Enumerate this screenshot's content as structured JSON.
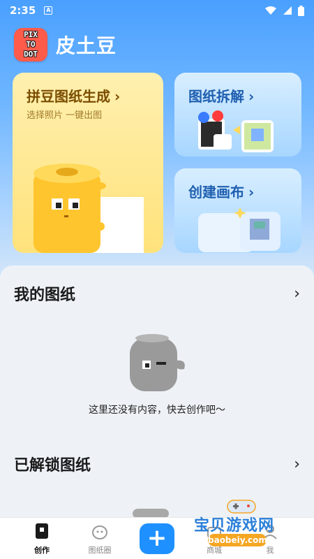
{
  "status_bar": {
    "time": "2:35",
    "notification_icon": "A"
  },
  "header": {
    "logo_lines": [
      "PIX",
      "TO",
      "DOT"
    ],
    "app_name": "皮土豆"
  },
  "cards": {
    "generate": {
      "title": "拼豆图纸生成",
      "chevron": "›",
      "subtitle": "选择照片 一键出图"
    },
    "split": {
      "title": "图纸拆解",
      "chevron": "›"
    },
    "canvas": {
      "title": "创建画布",
      "chevron": "›"
    }
  },
  "sections": {
    "my_patterns": {
      "title": "我的图纸",
      "more": "›",
      "empty_text": "这里还没有内容，快去创作吧～"
    },
    "unlocked": {
      "title": "已解锁图纸",
      "more": "›"
    }
  },
  "bottom_nav": {
    "items": [
      {
        "label": "创作",
        "active": true
      },
      {
        "label": "图纸圈",
        "active": false
      },
      {
        "label": "+",
        "active": false
      },
      {
        "label": "商城",
        "active": false
      },
      {
        "label": "我",
        "active": false
      }
    ]
  },
  "watermark": {
    "text": "宝贝游戏网",
    "url": "baobeiy.com"
  },
  "colors": {
    "accent": "#1e90ff",
    "header_bg": "#4aa0ff",
    "gen_card": "#ffe27a",
    "blue_card": "#a7d6ff"
  }
}
